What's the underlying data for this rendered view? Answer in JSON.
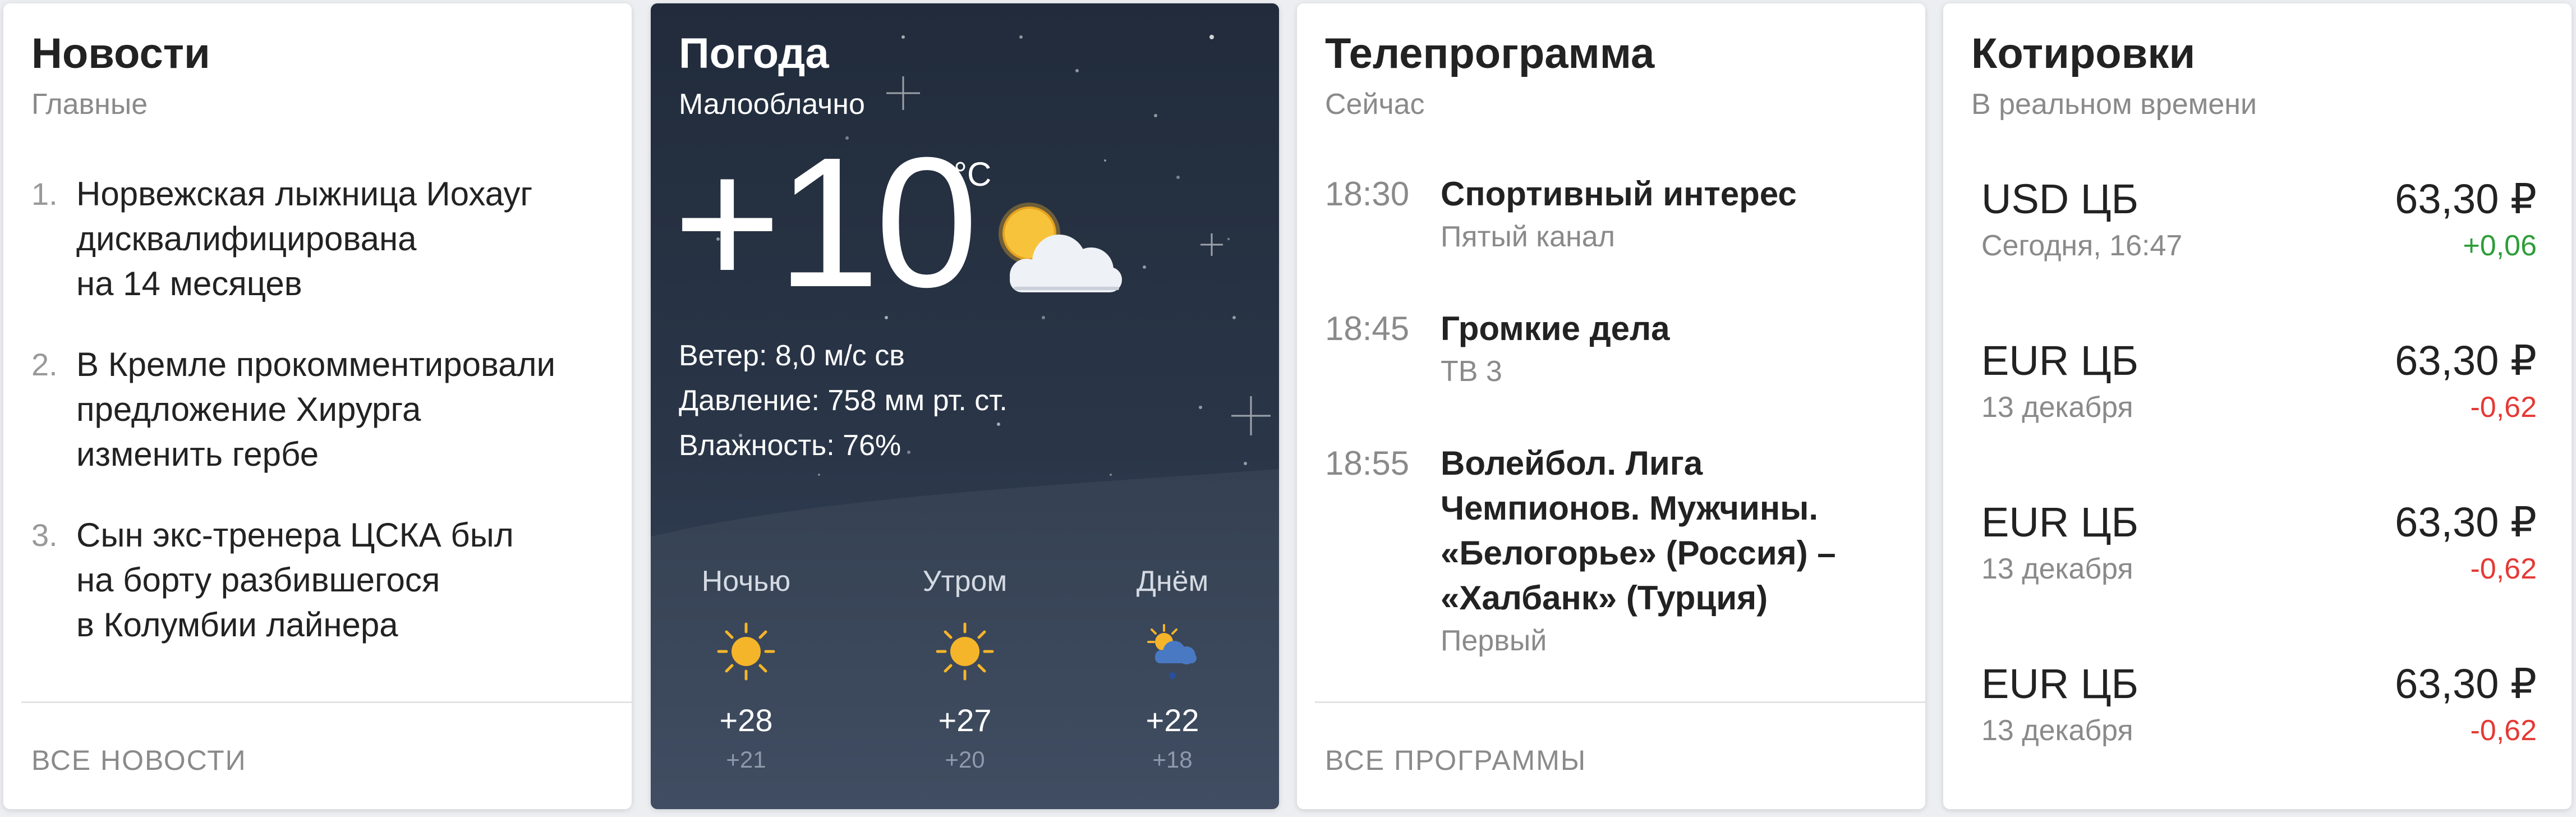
{
  "news": {
    "title": "Новости",
    "subtitle": "Главные",
    "items": [
      {
        "num": "1.",
        "text": "Норвежская лыжница Иохауг\nдисквалифицирована\nна 14 месяцев"
      },
      {
        "num": "2.",
        "text": "В Кремле прокомментировали\nпредложение Хирурга\nизменить гербе"
      },
      {
        "num": "3.",
        "text": "Сын экс-тренера ЦСКА был\nна борту разбившегося\nв Колумбии лайнера"
      }
    ],
    "footer": "ВСЕ НОВОСТИ"
  },
  "weather": {
    "title": "Погода",
    "subtitle": "Малооблачно",
    "temp": "+10",
    "unit": "°C",
    "current_icon": "sun-cloud-icon",
    "wind": "Ветер: 8,0 м/с св",
    "pressure": "Давление: 758 мм рт. ст.",
    "humidity": "Влажность: 76%",
    "parts": [
      {
        "label": "Ночью",
        "temp": "+28",
        "night": "+21",
        "icon": "sun-icon"
      },
      {
        "label": "Утром",
        "temp": "+27",
        "night": "+20",
        "icon": "sun-icon"
      },
      {
        "label": "Днём",
        "temp": "+22",
        "night": "+18",
        "icon": "sun-cloud-rain-icon"
      }
    ],
    "colors": {
      "sun": "#f5b52a",
      "cloud": "#4a79c4",
      "rain": "#2a4f9a"
    }
  },
  "tv": {
    "title": "Телепрограмма",
    "subtitle": "Сейчас",
    "items": [
      {
        "time": "18:30",
        "title": "Спортивный интерес",
        "channel": "Пятый канал"
      },
      {
        "time": "18:45",
        "title": "Громкие дела",
        "channel": "ТВ 3"
      },
      {
        "time": "18:55",
        "title": "Волейбол. Лига\nЧемпионов. Мужчины.\n«Белогорье» (Россия) –\n«Халбанк» (Турция)",
        "channel": "Первый"
      }
    ],
    "footer": "ВСЕ ПРОГРАММЫ"
  },
  "quotes": {
    "title": "Котировки",
    "subtitle": "В реальном времени",
    "items": [
      {
        "name": "USD ЦБ",
        "date": "Сегодня, 16:47",
        "value": "63,30 ₽",
        "change": "+0,06",
        "dir": "up"
      },
      {
        "name": "EUR ЦБ",
        "date": "13 декабря",
        "value": "63,30 ₽",
        "change": "-0,62",
        "dir": "down"
      },
      {
        "name": "EUR ЦБ",
        "date": "13 декабря",
        "value": "63,30 ₽",
        "change": "-0,62",
        "dir": "down"
      },
      {
        "name": "EUR ЦБ",
        "date": "13 декабря",
        "value": "63,30 ₽",
        "change": "-0,62",
        "dir": "down"
      }
    ],
    "colors": {
      "up": "#2e9d3a",
      "down": "#e53935"
    }
  }
}
